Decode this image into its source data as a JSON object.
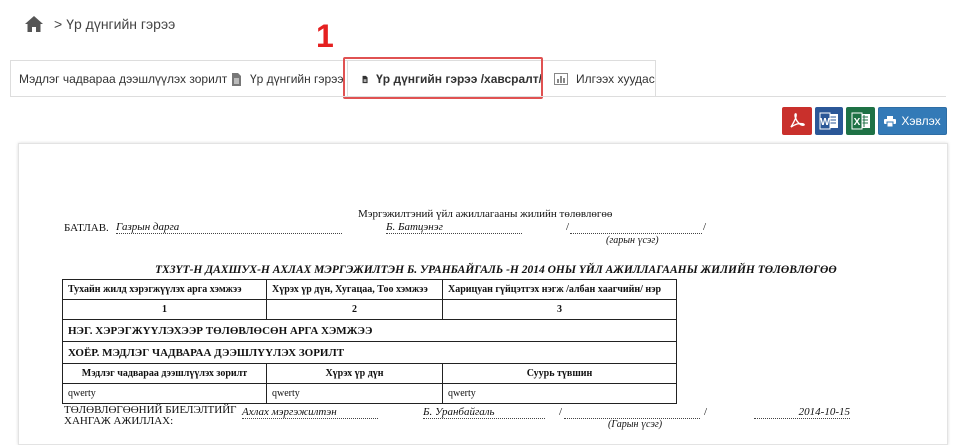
{
  "breadcrumb": {
    "separator": ">",
    "current": "Үр дүнгийн гэрээ"
  },
  "annotation": {
    "marker": "1"
  },
  "tabs": [
    {
      "label": "Мэдлэг чадвараа дээшлүүлэх зорилт",
      "icon": "none"
    },
    {
      "label": "Үр дүнгийн гэрээ",
      "icon": "file-text-icon"
    },
    {
      "label": "Үр дүнгийн гэрээ /хавсралт/",
      "icon": "file-text-icon"
    },
    {
      "label": "Илгээх хуудас",
      "icon": "bar-chart-icon"
    }
  ],
  "actions": {
    "pdf": "pdf-icon",
    "word": "word-icon",
    "excel": "excel-icon",
    "print_label": "Хэвлэх"
  },
  "document": {
    "form_title": "Мэргэжилтэний үйл ажиллагааны жилийн төлөвлөгөө",
    "approve_label": "БАТЛАВ.",
    "approve_position": "Газрын дарга",
    "approve_name": "Б. Батцэнэг",
    "slash1": "/",
    "slash2": "/",
    "signature_caption": "(гарын үсэг)",
    "plan_title": "ТХЗҮТ-Н ДАХШУХ-Н АХЛАХ МЭРГЭЖИЛТЭН Б. УРАНБАЙГАЛЬ -Н 2014 ОНЫ ҮЙЛ АЖИЛЛАГААНЫ ЖИЛИЙН ТӨЛӨВЛӨГӨӨ",
    "table": {
      "headers": [
        "Тухайн жилд хэрэгжүүлэх арга хэмжээ",
        "Хүрэх үр дүн, Хугацаа, Тоо хэмжээ",
        "Харицуан гүйцэтгэх нэгж /албан хаагчийн/ нэр"
      ],
      "numbers": [
        "1",
        "2",
        "3"
      ],
      "section1": "НЭГ. ХЭРЭГЖҮҮЛЭХЭЭР ТӨЛӨВЛӨСӨН АРГА ХЭМЖЭЭ",
      "section2": "ХОЁР. МЭДЛЭГ ЧАДВАРАА ДЭЭШЛҮҮЛЭХ ЗОРИЛТ",
      "subheaders": [
        "Мэдлэг чадвараа дээшлүүлэх зорилт",
        "Хүрэх үр дүн",
        "Суурь түвшин"
      ],
      "row": [
        "qwerty",
        "qwerty",
        "qwerty"
      ]
    },
    "footer": {
      "label_line1": "ТӨЛӨВЛӨГӨӨНИЙ БИЕЛЭЛТИЙГ",
      "label_line2": "ХАНГАЖ АЖИЛЛАХ:",
      "position": "Ахлах мэргэжилтэн",
      "name": "Б. Уранбайгаль",
      "slash1": "/",
      "slash2": "/",
      "date": "2014-10-15",
      "signature_caption": "(Гарын үсэг)"
    }
  },
  "colors": {
    "pdf": "#c9302c",
    "word": "#2b5797",
    "excel": "#1e7145",
    "print": "#337ab7",
    "highlight": "#e05252",
    "marker": "#e52020"
  }
}
